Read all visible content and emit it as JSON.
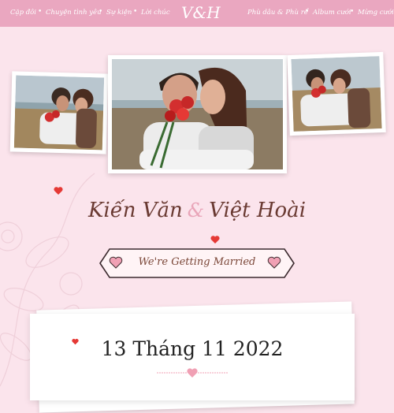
{
  "nav": {
    "left_items": [
      "Cặp đôi",
      "Chuyện tình yêu",
      "Sự kiện",
      "Lời chúc"
    ],
    "logo": "V&H",
    "right_items": [
      "Phù dâu & Phù rể",
      "Album cưới",
      "Mừng cưới"
    ]
  },
  "couple": {
    "groom": "Kiến Văn",
    "ampersand": "&",
    "bride": "Việt Hoài"
  },
  "ribbon_text": "We're Getting Married",
  "date": "13 Tháng 11 2022",
  "colors": {
    "background": "#fbe4ec",
    "nav": "#eaa7c0",
    "names": "#6a3a32",
    "accent_heart": "#e53935",
    "pink_heart": "#f0a0b4"
  },
  "icons": [
    "heart-icon",
    "ribbon-heart-icon"
  ]
}
